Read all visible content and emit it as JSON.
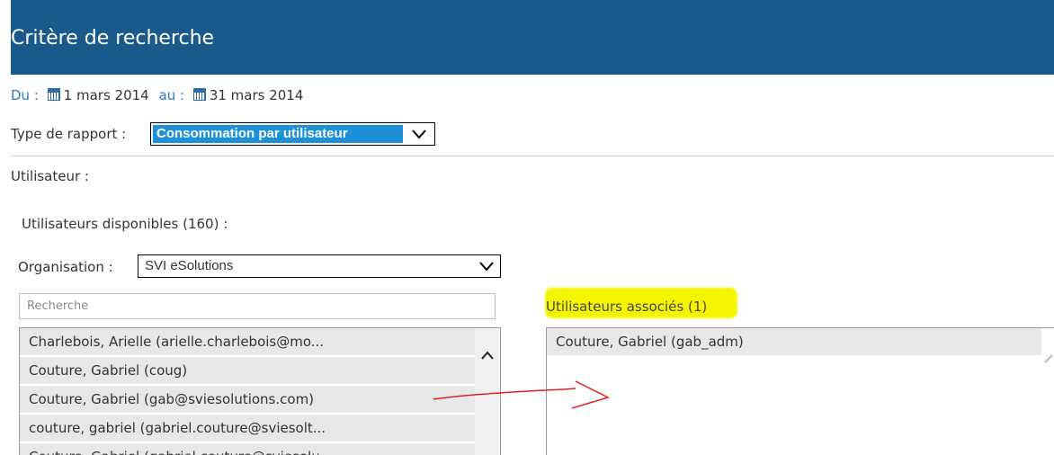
{
  "header": {
    "title": "Critère de recherche"
  },
  "dates": {
    "from_label": "Du :",
    "from_value": "1 mars 2014",
    "to_label": "au :",
    "to_value": "31 mars 2014"
  },
  "report": {
    "label": "Type de rapport :",
    "selected": "Consommation par utilisateur"
  },
  "user": {
    "label": "Utilisateur :",
    "available_label": "Utilisateurs disponibles (160) :",
    "organisation_label": "Organisation :",
    "organisation_selected": "SVI eSolutions",
    "search_placeholder": "Recherche",
    "available": [
      "Charlebois, Arielle (arielle.charlebois@mo...",
      "Couture, Gabriel (coug)",
      "Couture, Gabriel (gab@sviesolutions.com)",
      "couture, gabriel (gabriel.couture@sviesolt...",
      "Couture, Gabriel (gabriel.couture@sviesolu..."
    ],
    "associated_label": "Utilisateurs associés (1)",
    "associated": [
      "Couture, Gabriel (gab_adm)"
    ]
  },
  "colors": {
    "header_bg": "#1a5a8a",
    "selection_bg": "#1e90d8",
    "highlight": "#f5f500",
    "annotation": "#e02020"
  },
  "icons": [
    "calendar-icon",
    "chevron-down-icon",
    "scroll-up-icon",
    "red-arrow-annotation"
  ]
}
